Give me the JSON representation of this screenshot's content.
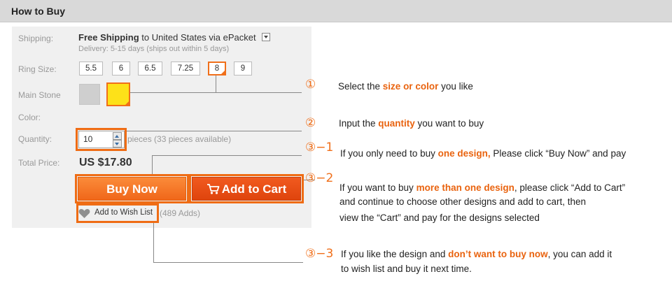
{
  "header": {
    "title": "How to Buy"
  },
  "product": {
    "labels": {
      "shipping": "Shipping:",
      "ring_size": "Ring Size:",
      "main_stone": "Main Stone",
      "color": "Color:",
      "quantity": "Quantity:",
      "total_price": "Total Price:"
    },
    "shipping": {
      "method": "Free Shipping",
      "to": "to",
      "destination": "United States via ePacket",
      "delivery": "Delivery: 5-15 days (ships out within 5 days)"
    },
    "ring_sizes": [
      "5.5",
      "6",
      "6.5",
      "7.25",
      "8",
      "9"
    ],
    "selected_size": "8",
    "stone_colors": [
      "#cfcfcf",
      "#fde119"
    ],
    "quantity": {
      "value": "10",
      "available": "pieces (33 pieces available)"
    },
    "total_price": "US $17.80",
    "buy_now_label": "Buy Now",
    "add_to_cart_label": "Add to Cart",
    "wish_list_label": "Add to Wish List",
    "wish_count": "(489 Adds)"
  },
  "steps": [
    {
      "number": "①",
      "lines": [
        [
          "Select the ",
          {
            "hl": "size or color"
          },
          " you like"
        ]
      ]
    },
    {
      "number": "②",
      "lines": [
        [
          "Input the ",
          {
            "hl": "quantity"
          },
          " you want to buy"
        ]
      ]
    },
    {
      "number": "③−1",
      "lines": [
        [
          "If you only need to buy ",
          {
            "hl": "one design,"
          },
          "  Please click “Buy Now” and pay"
        ]
      ]
    },
    {
      "number": "③−2",
      "lines": [
        [
          "If you want to buy ",
          {
            "hl": "more than one design"
          },
          ", please click “Add to Cart”"
        ],
        [
          "and continue to choose other designs and add to cart, then"
        ],
        [
          "view the “Cart” and pay for the designs selected"
        ]
      ]
    },
    {
      "number": "③−3",
      "lines": [
        [
          "If you like the design and ",
          {
            "hl": "don’t  want to buy now"
          },
          ", you can add it"
        ],
        [
          "to wish list and buy it next time."
        ]
      ]
    }
  ],
  "colors": {
    "accent": "#f06f1a",
    "button_buy": "#f47a26",
    "button_cart": "#e84e13",
    "panel": "#f0f0f0"
  }
}
